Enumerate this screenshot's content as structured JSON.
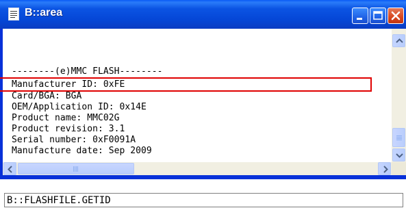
{
  "window": {
    "title": "B::area",
    "icon": "document-icon",
    "controls": [
      "minimize",
      "maximize",
      "close"
    ]
  },
  "area": {
    "lines": [
      "--------(e)MMC FLASH--------",
      "Manufacturer ID: 0xFE",
      "Card/BGA: BGA",
      "OEM/Application ID: 0x14E",
      "Product name: MMC02G",
      "Product revision: 3.1",
      "Serial number: 0xF0091A",
      "Manufacture date: Sep 2009"
    ],
    "highlighted_line": "Manufacturer ID: 0xFE",
    "highlight_color": "#e00000"
  },
  "command": {
    "value": "B::FLASHFILE.GETID"
  },
  "colors": {
    "titlebar": "#0546d6",
    "close_button": "#d8471f",
    "scrollbar_track": "#f1efe2",
    "scrollbar_thumb": "#b9cdfc"
  }
}
